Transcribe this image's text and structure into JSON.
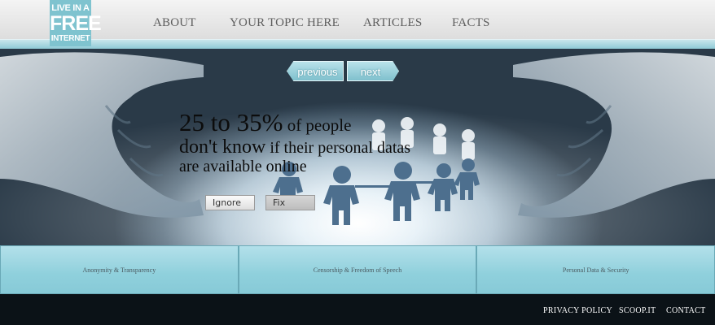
{
  "logo": {
    "line1": "LIVE IN A",
    "line2": "FREE",
    "line3": "INTERNET"
  },
  "nav": {
    "items": [
      "ABOUT",
      "YOUR TOPIC HERE",
      "ARTICLES",
      "FACTS"
    ]
  },
  "hero": {
    "prev_label": "previous",
    "next_label": "next",
    "headline": {
      "big1": "25 to 35%",
      "mid1": " of people",
      "big2": "don't know",
      "small2": " if their personal datas",
      "line3": "are available online"
    },
    "ignore_label": "Ignore",
    "fix_label": "Fix"
  },
  "categories": [
    "Anonymity & Transparency",
    "Censorship & Freedom of Speech",
    "Personal Data & Security"
  ],
  "footer": {
    "links": [
      "PRIVACY POLICY",
      "SCOOP.IT",
      "CONTACT"
    ]
  },
  "colors": {
    "accent": "#7fc3cf",
    "footer_bg": "#0b1217",
    "nav_text": "#5d5d5d"
  }
}
